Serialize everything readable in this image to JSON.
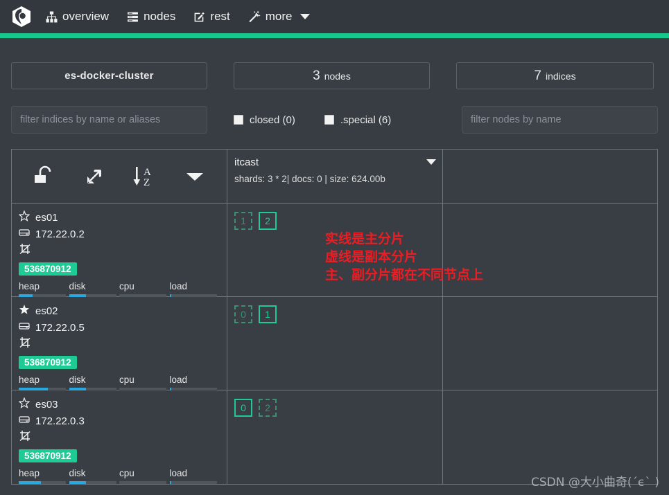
{
  "navbar": {
    "logo_icon": "elasticsearch-head-logo-icon",
    "items": [
      {
        "label": "overview",
        "icon": "sitemap-icon"
      },
      {
        "label": "nodes",
        "icon": "server-list-icon"
      },
      {
        "label": "rest",
        "icon": "edit-square-icon"
      },
      {
        "label": "more",
        "icon": "magic-wand-icon",
        "has_caret": true
      }
    ],
    "accent_color": "#15c98c"
  },
  "summary": {
    "cluster_name": "es-docker-cluster",
    "nodes_count": "3",
    "nodes_label": "nodes",
    "indices_count": "7",
    "indices_label": "indices"
  },
  "filters": {
    "indices_placeholder": "filter indices by name or aliases",
    "closed_label": "closed (0)",
    "closed_checked": false,
    "special_label": ".special (6)",
    "special_checked": false,
    "nodes_placeholder": "filter nodes by name"
  },
  "toolbar": {
    "unlock_icon": "unlock-icon",
    "expand_icon": "expand-arrows-icon",
    "sort_az_icon": "sort-alpha-asc-icon",
    "more_caret_icon": "chevron-down-icon"
  },
  "index": {
    "name": "itcast",
    "stats": "shards: 3 * 2| docs: 0 | size: 624.00b",
    "caret_icon": "chevron-down-icon"
  },
  "metric_labels": {
    "heap": "heap",
    "disk": "disk",
    "cpu": "cpu",
    "load": "load"
  },
  "nodes": [
    {
      "name": "es01",
      "master": false,
      "star_icon": "star-outline-icon",
      "ip": "172.22.0.2",
      "ip_icon": "hdd-icon",
      "shutdown_icon": "node-shutdown-icon",
      "memory": "536870912",
      "heap_pct": 30,
      "disk_pct": 36,
      "cpu_pct": 0,
      "load_pct": 4,
      "shards": [
        {
          "num": "1",
          "type": "replica"
        },
        {
          "num": "2",
          "type": "primary"
        }
      ]
    },
    {
      "name": "es02",
      "master": true,
      "star_icon": "star-filled-icon",
      "ip": "172.22.0.5",
      "ip_icon": "hdd-icon",
      "shutdown_icon": "node-shutdown-icon",
      "memory": "536870912",
      "heap_pct": 62,
      "disk_pct": 36,
      "cpu_pct": 0,
      "load_pct": 4,
      "shards": [
        {
          "num": "0",
          "type": "replica"
        },
        {
          "num": "1",
          "type": "primary"
        }
      ]
    },
    {
      "name": "es03",
      "master": false,
      "star_icon": "star-outline-icon",
      "ip": "172.22.0.3",
      "ip_icon": "hdd-icon",
      "shutdown_icon": "node-shutdown-icon",
      "memory": "536870912",
      "heap_pct": 47,
      "disk_pct": 36,
      "cpu_pct": 0,
      "load_pct": 4,
      "shards": [
        {
          "num": "0",
          "type": "primary"
        },
        {
          "num": "2",
          "type": "replica"
        }
      ]
    }
  ],
  "annotation": {
    "line1": "实线是主分片",
    "line2": "虚线是副本分片",
    "line3": "主、副分片都在不同节点上",
    "color": "#ee1c23"
  },
  "watermark": "CSDN @大小曲奇(´ϵ` )"
}
